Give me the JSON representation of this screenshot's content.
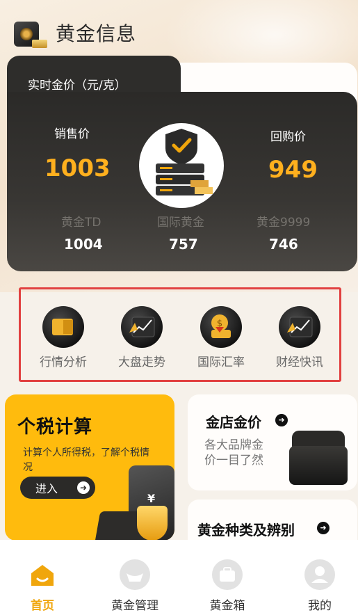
{
  "header": {
    "title": "黄金信息"
  },
  "price_card": {
    "title": "实时金价（元/克）",
    "sell_label": "销售价",
    "sell_value": "1003",
    "buy_label": "回购价",
    "buy_value": "949",
    "sub_prices": [
      {
        "label": "黄金TD",
        "value": "1004"
      },
      {
        "label": "国际黄金",
        "value": "757"
      },
      {
        "label": "黄金9999",
        "value": "746"
      }
    ]
  },
  "quick_entries": [
    {
      "label": "行情分析",
      "icon": "market-analysis-icon"
    },
    {
      "label": "大盘走势",
      "icon": "trend-chart-icon"
    },
    {
      "label": "国际汇率",
      "icon": "exchange-rate-icon"
    },
    {
      "label": "财经快讯",
      "icon": "finance-news-icon"
    }
  ],
  "tax_card": {
    "title": "个税计算",
    "desc": "计算个人所得税，了解个税情况",
    "button": "进入"
  },
  "shop_card": {
    "title": "金店金价",
    "desc": "各大品牌金价一目了然"
  },
  "kind_card": {
    "title": "黄金种类及辨别"
  },
  "tabbar": [
    {
      "label": "首页",
      "active": true
    },
    {
      "label": "黄金管理",
      "active": false
    },
    {
      "label": "黄金箱",
      "active": false
    },
    {
      "label": "我的",
      "active": false
    }
  ],
  "colors": {
    "accent": "#ffb01e",
    "tax_card": "#ffbb0d",
    "card_dark": "#2e2d2b",
    "highlight_border": "#e14040"
  }
}
